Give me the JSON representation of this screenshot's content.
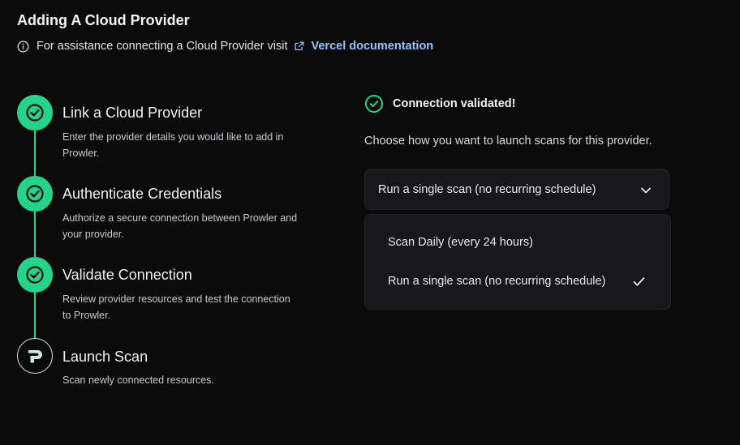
{
  "header": {
    "title": "Adding A Cloud Provider",
    "help_text": "For assistance connecting a Cloud Provider visit",
    "link_text": "Vercel documentation",
    "info_icon": "info-icon",
    "external_icon": "external-link-icon"
  },
  "steps": [
    {
      "title": "Link a Cloud Provider",
      "description": "Enter the provider details you would like to add in Prowler.",
      "status": "complete",
      "icon": "check-icon"
    },
    {
      "title": "Authenticate Credentials",
      "description": "Authorize a secure connection between Prowler and your provider.",
      "status": "complete",
      "icon": "check-icon"
    },
    {
      "title": "Validate Connection",
      "description": "Review provider resources and test the connection to Prowler.",
      "status": "complete",
      "icon": "check-icon"
    },
    {
      "title": "Launch Scan",
      "description": "Scan newly connected resources.",
      "status": "current",
      "icon": "prowler-logo-icon"
    }
  ],
  "panel": {
    "validated_text": "Connection validated!",
    "choose_text": "Choose how you want to launch scans for this provider.",
    "select_value": "Run a single scan (no recurring schedule)",
    "options": [
      {
        "label": "Scan Daily (every 24 hours)",
        "selected": false
      },
      {
        "label": "Run a single scan (no recurring schedule)",
        "selected": true
      }
    ]
  },
  "colors": {
    "background": "#0b0b0c",
    "accent": "#22d58a",
    "link": "#8fc4ff",
    "surface": "#18181b"
  }
}
